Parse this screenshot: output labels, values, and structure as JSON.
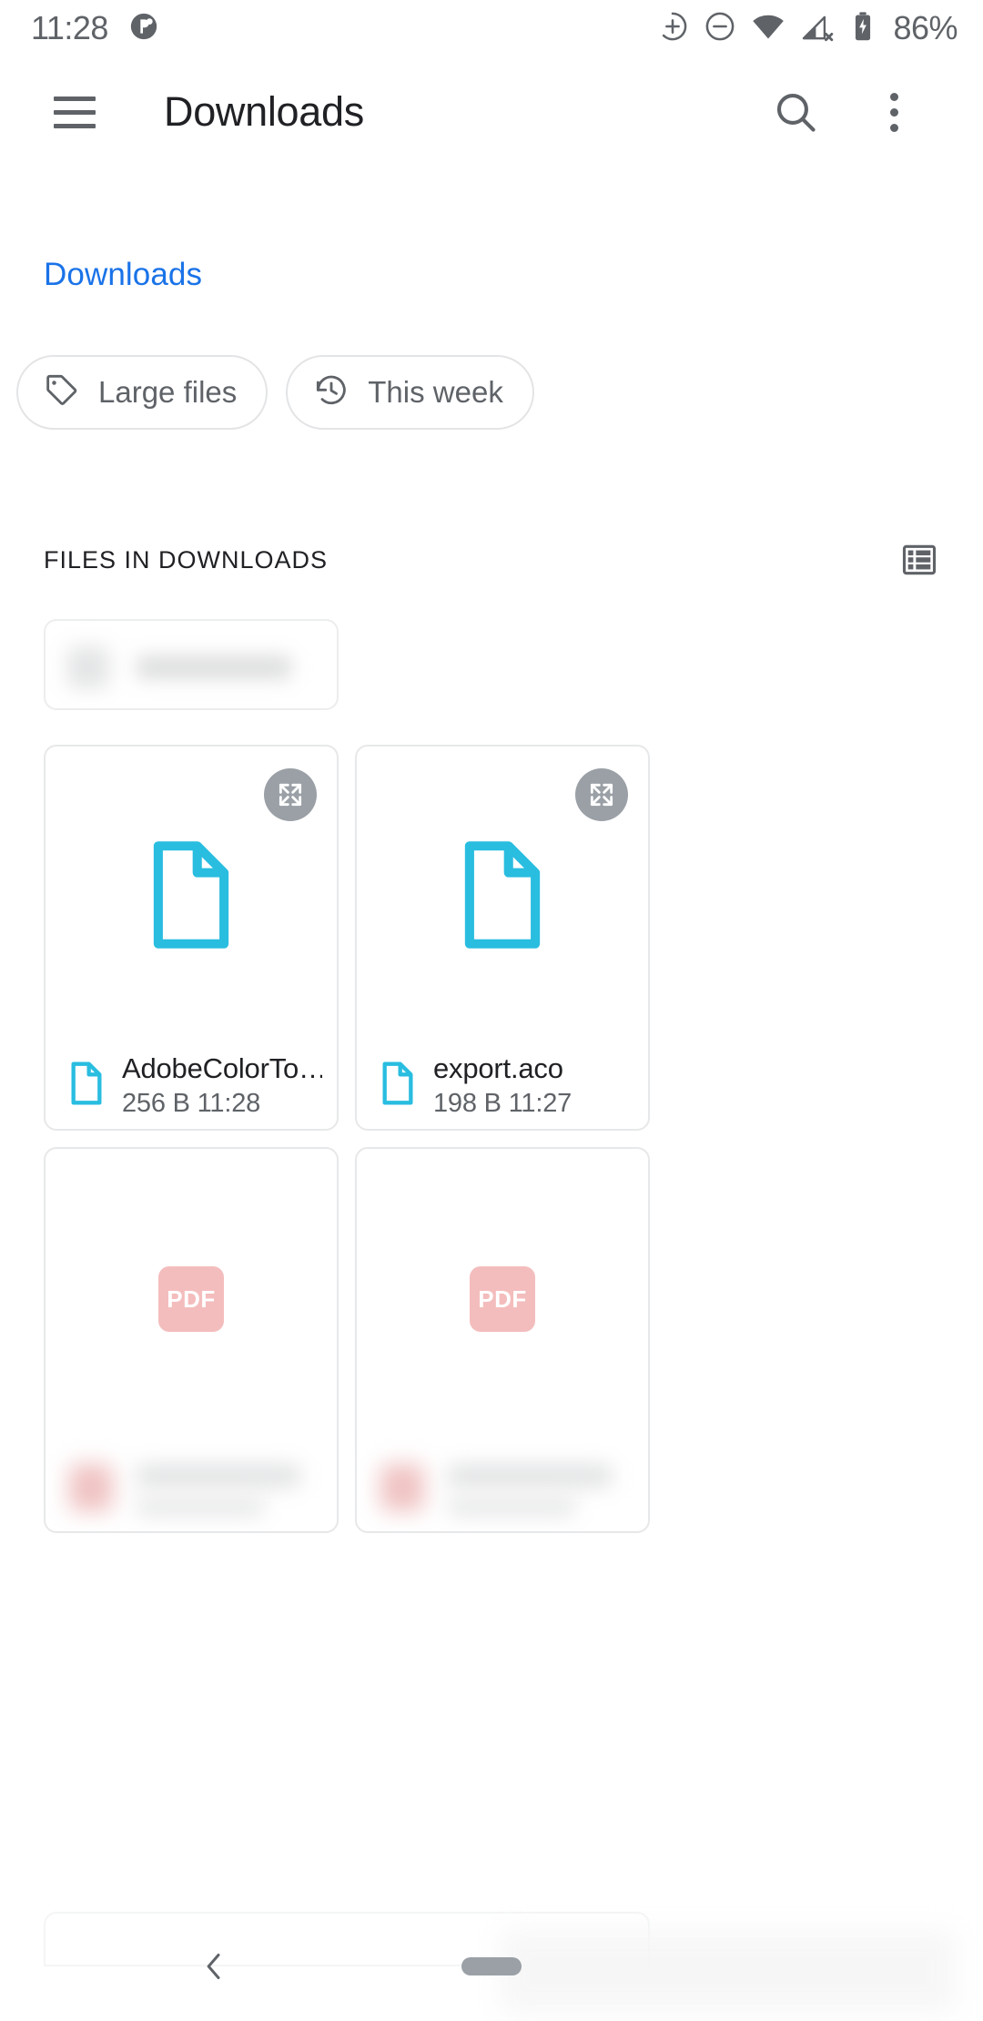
{
  "status_bar": {
    "time": "11:28",
    "battery_percent": "86%",
    "icons": [
      "notification-app-icon",
      "zoom-in-icon",
      "zoom-out-icon",
      "wifi-icon",
      "cellular-no-signal-icon",
      "battery-charging-icon"
    ]
  },
  "app_bar": {
    "title": "Downloads",
    "menu_icon": "hamburger-menu-icon",
    "search_icon": "search-icon",
    "overflow_icon": "more-vertical-icon"
  },
  "breadcrumb": {
    "current": "Downloads"
  },
  "chips": [
    {
      "label": "Large files",
      "icon": "tag-icon"
    },
    {
      "label": "This week",
      "icon": "history-clock-icon"
    }
  ],
  "section": {
    "title": "FILES IN DOWNLOADS",
    "view_toggle_icon": "list-view-icon"
  },
  "files": [
    {
      "name": "AdobeColorTo…",
      "meta": "256 B 11:28",
      "thumb_kind": "document",
      "redacted": false,
      "has_expand": true
    },
    {
      "name": "export.aco",
      "meta": "198 B 11:27",
      "thumb_kind": "document",
      "redacted": false,
      "has_expand": true
    },
    {
      "name": "",
      "meta": "",
      "thumb_kind": "pdf",
      "pdf_label": "PDF",
      "redacted": true,
      "has_expand": false
    },
    {
      "name": "",
      "meta": "",
      "thumb_kind": "pdf",
      "pdf_label": "PDF",
      "redacted": true,
      "has_expand": false
    }
  ],
  "nav_bar": {
    "back_icon": "back-chevron-icon",
    "home_icon": "home-pill-icon"
  },
  "colors": {
    "accent_blue": "#1a73e8",
    "doc_cyan": "#29bde0",
    "pdf_pink": "#f4bdbd",
    "text_primary": "#202124",
    "text_secondary": "#5f6368"
  }
}
